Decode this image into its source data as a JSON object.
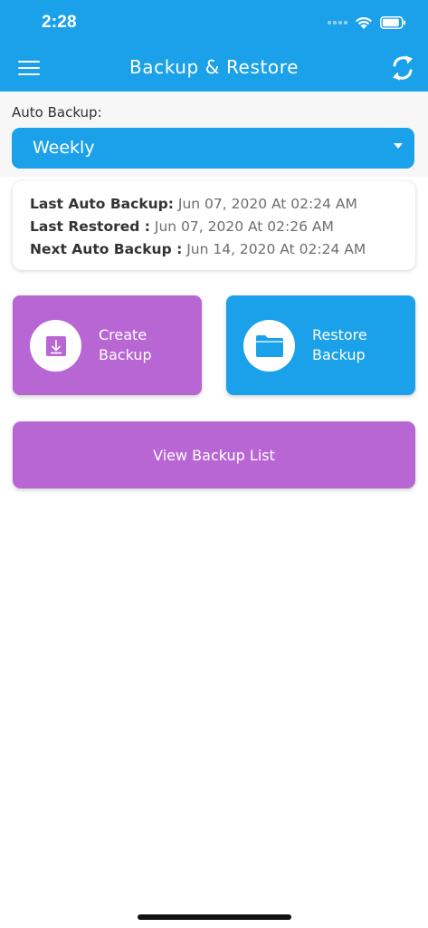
{
  "status_bar": {
    "time": "2:28"
  },
  "header": {
    "title": "Backup & Restore"
  },
  "auto_backup": {
    "label": "Auto Backup:",
    "selected": "Weekly"
  },
  "info": [
    {
      "key": "Last Auto Backup:",
      "value": " Jun 07, 2020 At 02:24 AM"
    },
    {
      "key": "Last Restored :",
      "value": " Jun 07, 2020 At 02:26 AM"
    },
    {
      "key": "Next Auto Backup :",
      "value": " Jun 14, 2020 At 02:24 AM"
    }
  ],
  "actions": {
    "create": {
      "line1": "Create",
      "line2": "Backup"
    },
    "restore": {
      "line1": "Restore",
      "line2": "Backup"
    }
  },
  "view_list": {
    "label": "View Backup List"
  },
  "colors": {
    "primary": "#1ba1e9",
    "accent": "#b766d3"
  },
  "icons": [
    "menu-icon",
    "sync-icon",
    "caret-down-icon",
    "download-icon",
    "folder-icon",
    "wifi-icon",
    "battery-icon"
  ]
}
